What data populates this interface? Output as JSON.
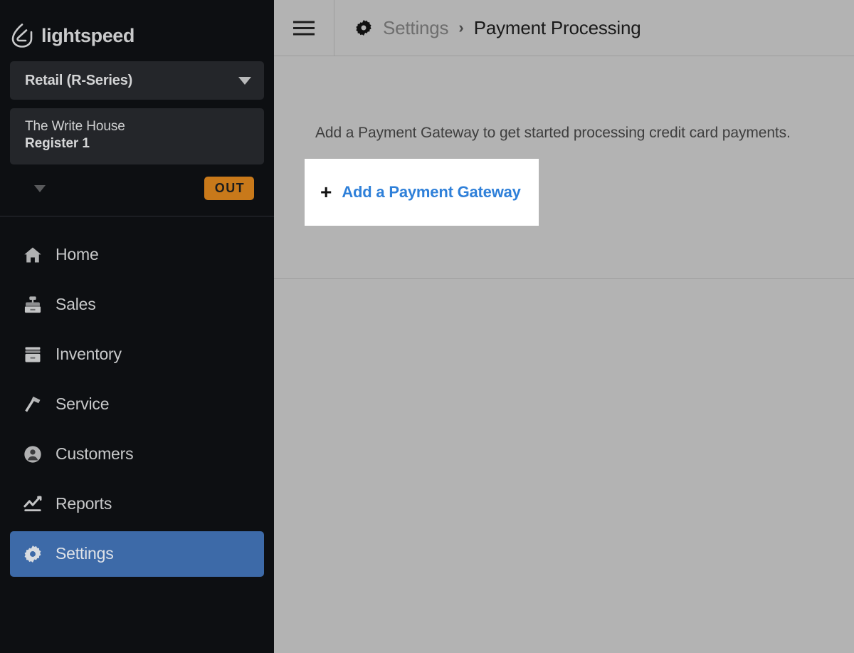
{
  "brand": {
    "name": "lightspeed",
    "logo_icon": "lightspeed-flame-logo"
  },
  "sidebar": {
    "product_selector": {
      "label": "Retail (R-Series)",
      "caret_icon": "chevron-down-icon"
    },
    "register": {
      "store_name": "The Write House",
      "register_name": "Register 1",
      "expand_icon": "chevron-down-icon",
      "status_label": "OUT",
      "status_color": "#c8791a"
    },
    "nav_items": [
      {
        "label": "Home",
        "icon": "home-icon",
        "active": false
      },
      {
        "label": "Sales",
        "icon": "cash-register-icon",
        "active": false
      },
      {
        "label": "Inventory",
        "icon": "inventory-box-icon",
        "active": false
      },
      {
        "label": "Service",
        "icon": "hammer-icon",
        "active": false
      },
      {
        "label": "Customers",
        "icon": "user-circle-icon",
        "active": false
      },
      {
        "label": "Reports",
        "icon": "line-chart-icon",
        "active": false
      },
      {
        "label": "Settings",
        "icon": "gear-icon",
        "active": true
      }
    ],
    "active_color": "#3d6aa8",
    "background": "#0d0f12"
  },
  "header": {
    "menu_icon": "hamburger-menu-icon",
    "section_icon": "gear-icon",
    "breadcrumb": {
      "parent": "Settings",
      "separator": "›",
      "current": "Payment Processing"
    }
  },
  "main": {
    "empty_state_message": "Add a Payment Gateway to get started processing credit card payments.",
    "add_gateway_card": {
      "plus_icon": "plus-icon",
      "label": "Add a Payment Gateway",
      "link_color": "#2f80d9"
    },
    "background": "#b3b3b3"
  }
}
